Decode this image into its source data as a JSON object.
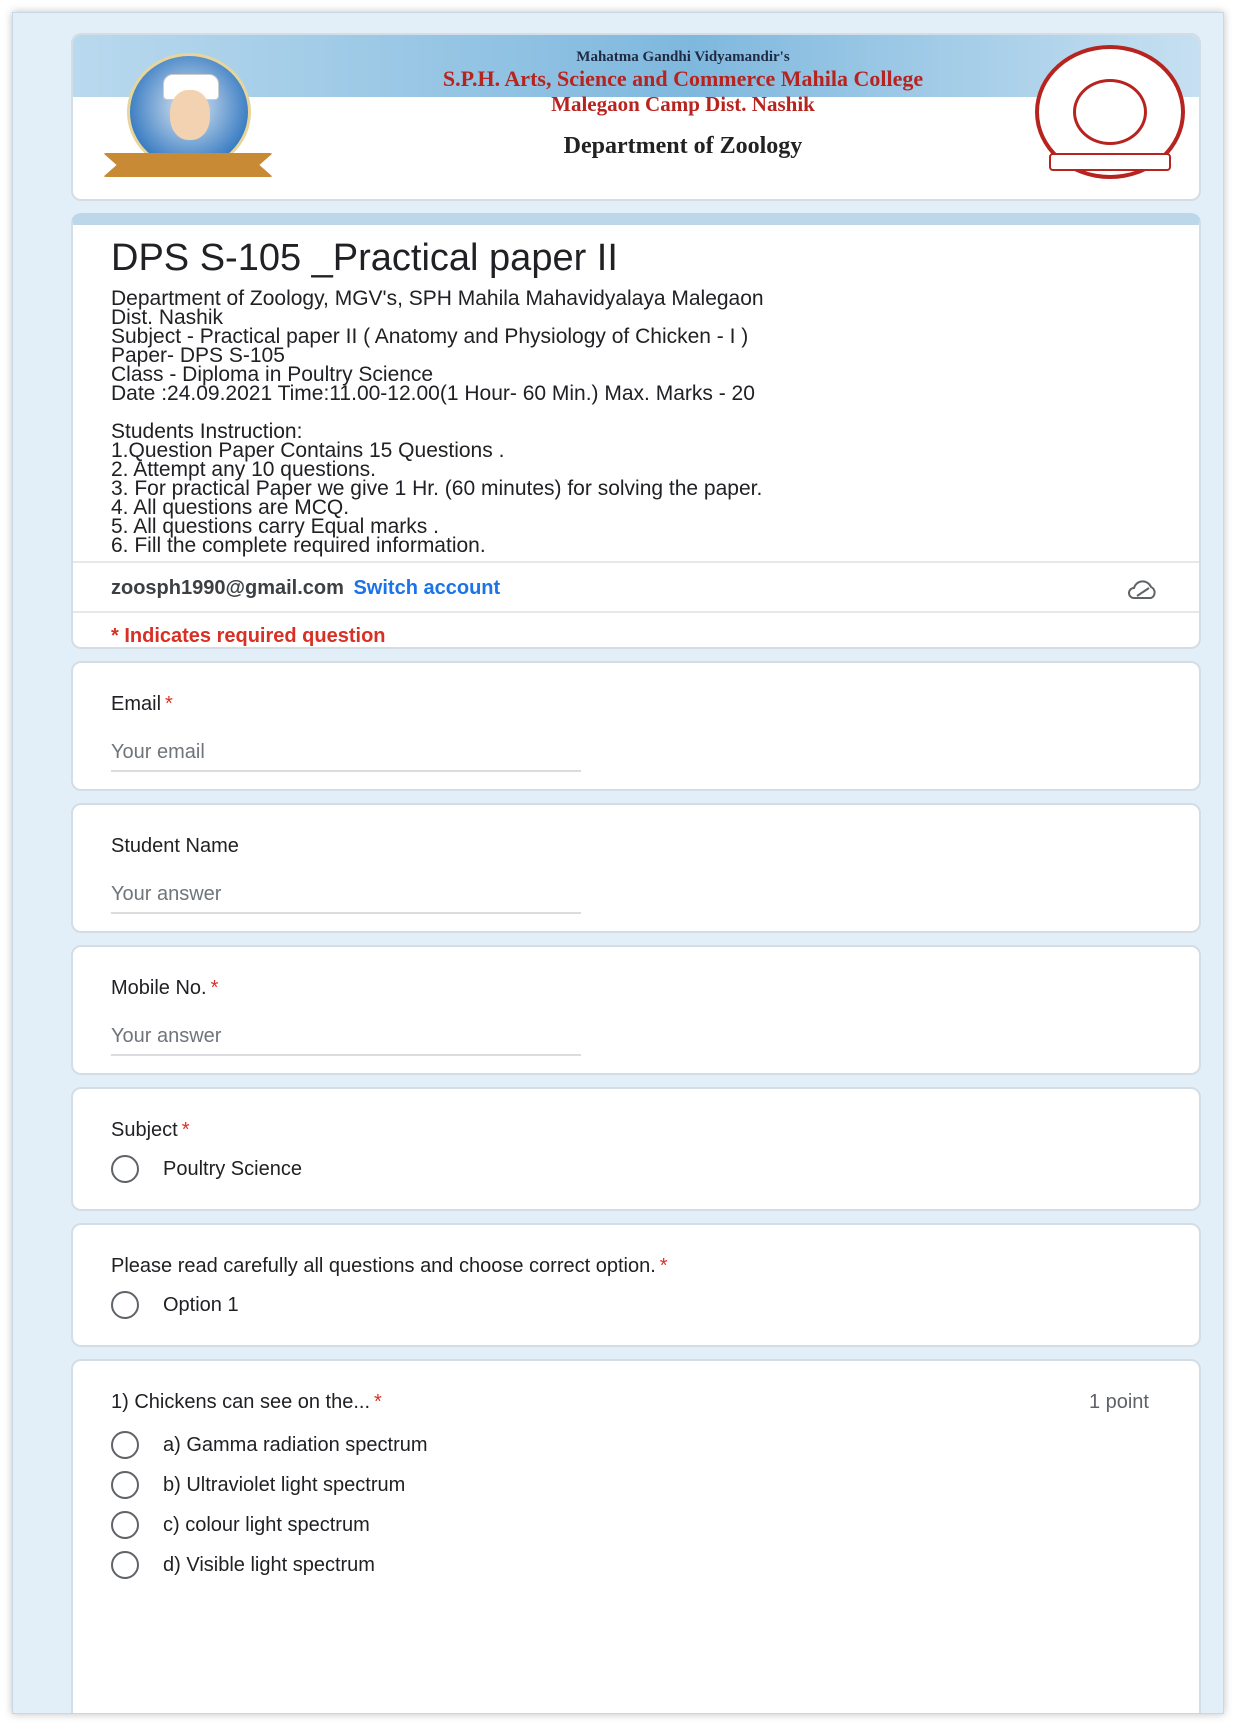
{
  "banner": {
    "trust_name": "Mahatma Gandhi Vidyamandir's",
    "college_name": "S.P.H. Arts, Science and Commerce Mahila College",
    "location": "Malegaon Camp Dist. Nashik",
    "department": "Department of Zoology"
  },
  "form": {
    "title": "DPS S-105 _Practical paper II",
    "description": "Department of Zoology, MGV's, SPH Mahila Mahavidyalaya Malegaon\nDist. Nashik\nSubject -  Practical paper II  ( Anatomy and Physiology of Chicken - I )\nPaper- DPS S-105\nClass - Diploma in Poultry Science\nDate :24.09.2021  Time:11.00-12.00(1 Hour- 60 Min.)   Max. Marks - 20\n\n  Students Instruction:\n1.Question Paper Contains 15 Questions .\n2. Attempt any 10  questions.\n3. For practical Paper we give 1 Hr. (60 minutes) for solving the paper.\n4. All questions are MCQ.\n5. All questions carry Equal marks .\n6. Fill the complete required information.",
    "account_email": "zoosph1990@gmail.com",
    "switch_account": "Switch account",
    "required_note": "* Indicates required question"
  },
  "questions": {
    "email": {
      "label": "Email",
      "star": "*",
      "placeholder": "Your email"
    },
    "student_name": {
      "label": "Student Name",
      "placeholder": "Your answer"
    },
    "mobile": {
      "label": "Mobile No.",
      "star": "*",
      "placeholder": "Your answer"
    },
    "subject": {
      "label": "Subject",
      "star": "*",
      "option": "Poultry Science"
    },
    "instruction": {
      "label": "Please read carefully all questions and choose correct option.",
      "star": "*",
      "option": "Option 1"
    },
    "q1": {
      "label": "1) Chickens can see on the...",
      "star": "*",
      "points": "1 point",
      "options": [
        "a) Gamma radiation spectrum",
        "b) Ultraviolet light spectrum",
        "c) colour light spectrum",
        "d) Visible light spectrum"
      ]
    }
  },
  "icons": {
    "cloud": "cloud-icon",
    "portrait": "founder-portrait",
    "seal": "college-seal"
  },
  "colors": {
    "accent": "#1a73e8",
    "required": "#d93025",
    "banner_red": "#b7231f",
    "header_band": "#bcd7ea"
  }
}
